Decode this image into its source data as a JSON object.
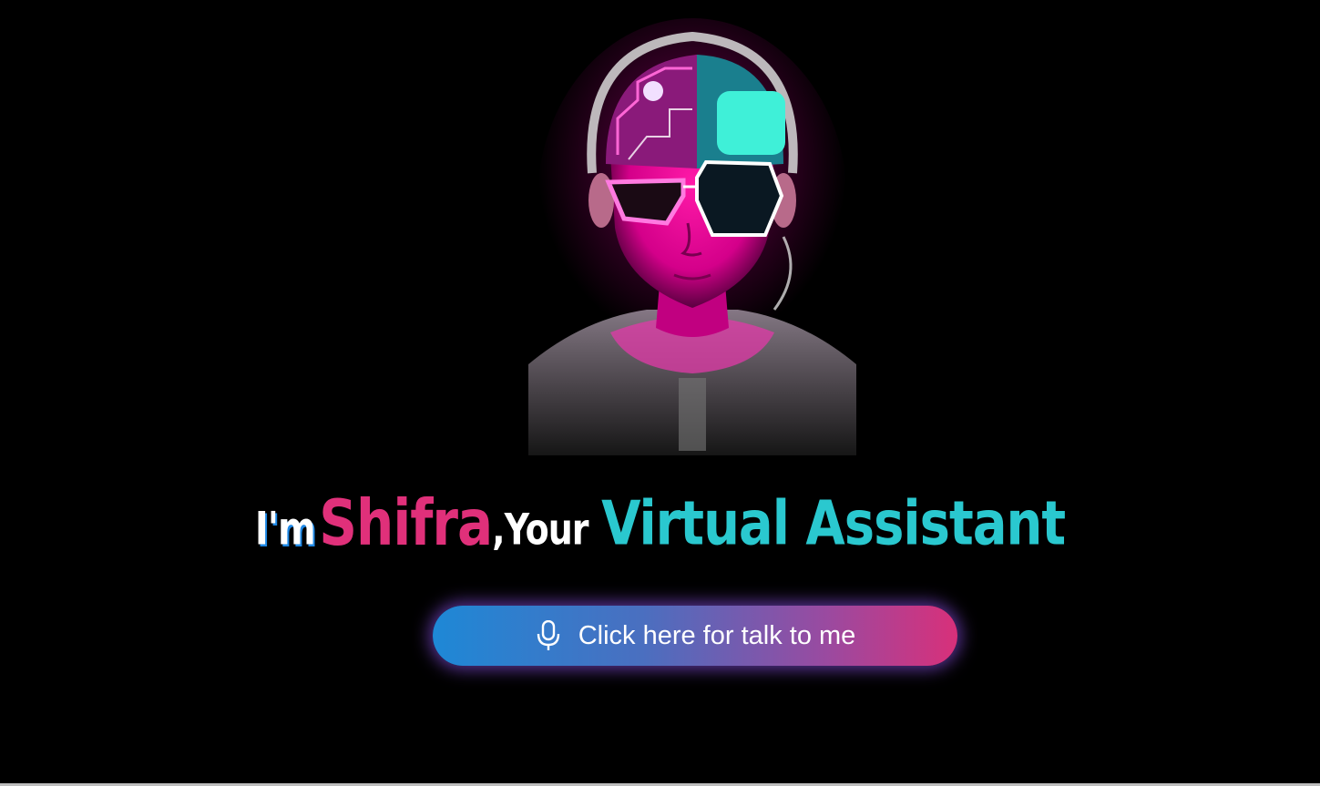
{
  "avatar": {
    "icon": "neon-cyborg-avatar-image"
  },
  "headline": {
    "prefix": "I'm",
    "name": "Shifra",
    "connector": ",Your",
    "role": "Virtual Assistant"
  },
  "talk_button": {
    "label": "Click here for talk to me",
    "icon": "microphone-icon"
  },
  "colors": {
    "background": "#000000",
    "name_accent": "#e0307a",
    "role_accent": "#2ac8cf",
    "button_gradient_start": "#1e88d6",
    "button_gradient_end": "#d8307a"
  }
}
